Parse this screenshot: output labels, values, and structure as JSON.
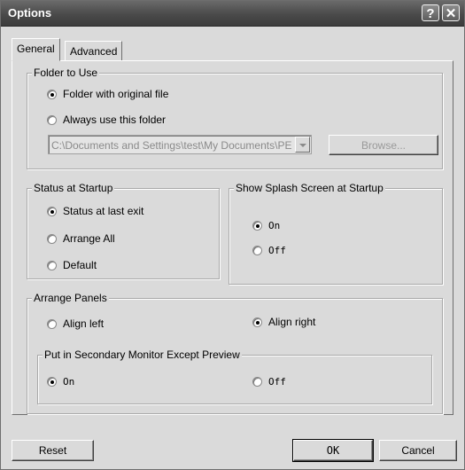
{
  "window": {
    "title": "Options",
    "help_glyph": "?",
    "close_glyph": "✕"
  },
  "tabs": [
    {
      "label": "General"
    },
    {
      "label": "Advanced"
    }
  ],
  "folder_group": {
    "legend": "Folder to Use",
    "radio_original": "Folder with original file",
    "radio_always": "Always use this folder",
    "selected": "Folder with original file",
    "path_value": "C:\\Documents and Settings\\test\\My Documents\\PE",
    "browse_label": "Browse..."
  },
  "status_group": {
    "legend": "Status at Startup",
    "options": [
      "Status at last exit",
      "Arrange All",
      "Default"
    ],
    "selected": "Status at last exit"
  },
  "splash_group": {
    "legend": "Show Splash Screen at Startup",
    "options": [
      "On",
      "Off"
    ],
    "selected": "On"
  },
  "arrange_group": {
    "legend": "Arrange Panels",
    "options": [
      "Align left",
      "Align right"
    ],
    "selected": "Align right"
  },
  "secondary_group": {
    "legend": "Put in Secondary Monitor Except Preview",
    "options": [
      "On",
      "Off"
    ],
    "selected": "On"
  },
  "buttons": {
    "reset": "Reset",
    "ok": "OK",
    "cancel": "Cancel"
  }
}
